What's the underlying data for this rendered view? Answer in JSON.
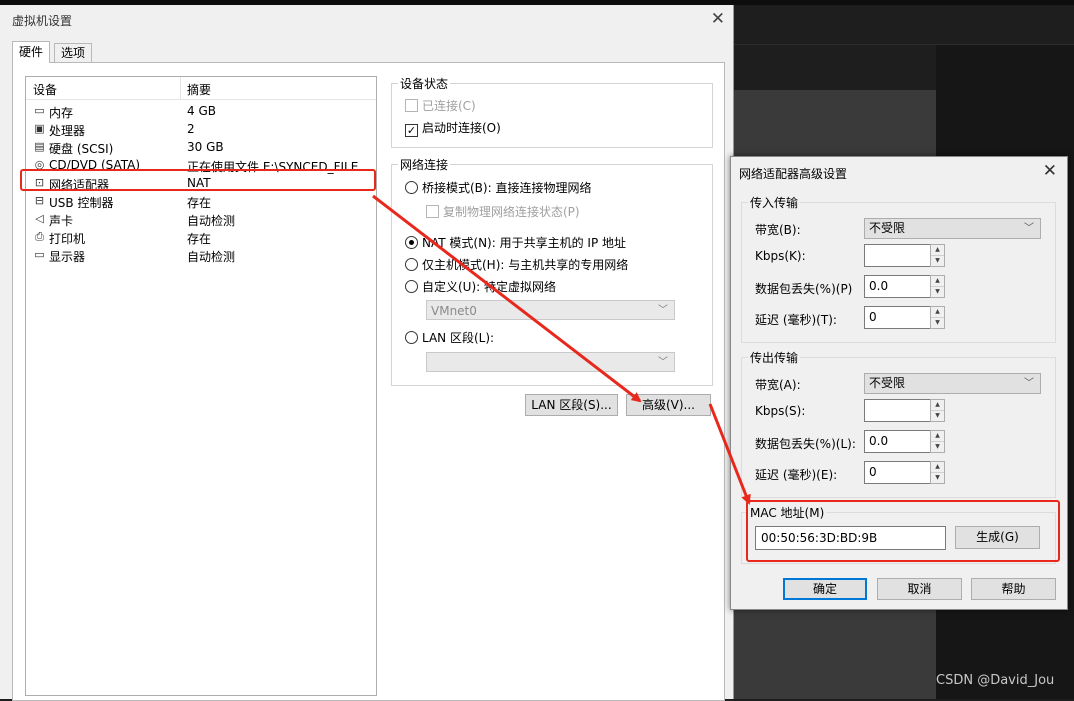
{
  "main_dialog": {
    "title": "虚拟机设置",
    "tabs": [
      "硬件",
      "选项"
    ],
    "device_list": {
      "headers": [
        "设备",
        "摘要"
      ],
      "rows": [
        {
          "icon": "memory-icon",
          "name": "内存",
          "value": "4 GB"
        },
        {
          "icon": "cpu-icon",
          "name": "处理器",
          "value": "2"
        },
        {
          "icon": "hard-disk-icon",
          "name": "硬盘 (SCSI)",
          "value": "30 GB"
        },
        {
          "icon": "cd-dvd-icon",
          "name": "CD/DVD (SATA)",
          "value": "正在使用文件 E:\\SYNCED_FILE..."
        },
        {
          "icon": "network-adapter-icon",
          "name": "网络适配器",
          "value": "NAT"
        },
        {
          "icon": "usb-icon",
          "name": "USB 控制器",
          "value": "存在"
        },
        {
          "icon": "sound-card-icon",
          "name": "声卡",
          "value": "自动检测"
        },
        {
          "icon": "printer-icon",
          "name": "打印机",
          "value": "存在"
        },
        {
          "icon": "display-icon",
          "name": "显示器",
          "value": "自动检测"
        }
      ]
    },
    "device_status": {
      "label": "设备状态",
      "connected": "已连接(C)",
      "connect_at_power_on": "启动时连接(O)"
    },
    "network_connection": {
      "label": "网络连接",
      "bridged": "桥接模式(B): 直接连接物理网络",
      "replicate_state": "复制物理网络连接状态(P)",
      "nat": "NAT 模式(N): 用于共享主机的 IP 地址",
      "host_only": "仅主机模式(H): 与主机共享的专用网络",
      "custom": "自定义(U): 特定虚拟网络",
      "custom_value": "VMnet0",
      "lan_segment": "LAN 区段(L):",
      "lan_segment_value": ""
    },
    "buttons": {
      "lan_segments": "LAN 区段(S)...",
      "advanced": "高级(V)..."
    }
  },
  "adv_dialog": {
    "title": "网络适配器高级设置",
    "incoming": {
      "label": "传入传输",
      "bandwidth_label": "带宽(B):",
      "bandwidth_value": "不受限",
      "kbps_label": "Kbps(K):",
      "kbps_value": "",
      "loss_label": "数据包丢失(%)(P)",
      "loss_value": "0.0",
      "latency_label": "延迟 (毫秒)(T):",
      "latency_value": "0"
    },
    "outgoing": {
      "label": "传出传输",
      "bandwidth_label": "带宽(A):",
      "bandwidth_value": "不受限",
      "kbps_label": "Kbps(S):",
      "kbps_value": "",
      "loss_label": "数据包丢失(%)(L):",
      "loss_value": "0.0",
      "latency_label": "延迟 (毫秒)(E):",
      "latency_value": "0"
    },
    "mac": {
      "label": "MAC 地址(M)",
      "value": "00:50:56:3D:BD:9B",
      "generate_button": "生成(G)"
    },
    "buttons": {
      "ok": "确定",
      "cancel": "取消",
      "help": "帮助"
    }
  },
  "watermark": "CSDN @David_Jou",
  "colors": {
    "annotation_red": "#e8281c",
    "focus_blue": "#0078d7"
  }
}
